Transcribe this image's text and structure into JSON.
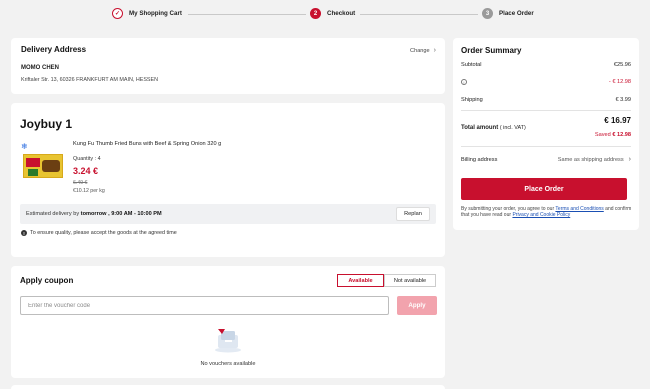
{
  "steps": [
    {
      "num": "✓",
      "label": "My Shopping Cart"
    },
    {
      "num": "2",
      "label": "Checkout"
    },
    {
      "num": "3",
      "label": "Place Order"
    }
  ],
  "delivery": {
    "title": "Delivery Address",
    "change": "Change",
    "name": "MOMO CHEN",
    "address": "Kriftaler Str. 13, 60326 FRANKFURT AM MAIN, HESSEN"
  },
  "seller": {
    "title": "Joybuy 1",
    "product_name": "Kung Fu Thumb Fried Buns with Beef & Spring Onion 320 g",
    "quantity": "Quantity : 4",
    "price": "3.24 €",
    "old_price": "6.49 €",
    "per_kg": "€10.12 per kg",
    "est_prefix": "Estimated delivery by",
    "est_value": "tomorrow , 9:00 AM - 10:00 PM",
    "replan": "Replan",
    "note": "To ensure quality, please accept the goods at the agreed time"
  },
  "coupon": {
    "title": "Apply coupon",
    "tab_available": "Available",
    "tab_not_available": "Not available",
    "placeholder": "Enter the voucher code",
    "apply": "Apply",
    "empty": "No vouchers available"
  },
  "summary": {
    "title": "Order Summary",
    "subtotal_label": "Subtotal",
    "subtotal_value": "€25.96",
    "discount_value": "- € 12.98",
    "shipping_label": "Shipping",
    "shipping_value": "€ 3.99",
    "total_value": "€ 16.97",
    "total_label": "Total amount",
    "total_suffix": "( incl. VAT)",
    "saved_label": "Saved",
    "saved_value": "€ 12.98",
    "billing_label": "Billing address",
    "billing_value": "Same as shipping address",
    "place_order": "Place Order",
    "terms_prefix": "By submitting your order, you agree to our",
    "terms_link": "Terms and Conditions",
    "terms_mid": "and confirm that you have read our",
    "privacy_link": "Privacy and Cookie Policy"
  },
  "colors": {
    "accent": "#c8102e",
    "background": "#f2f2f2",
    "apply_disabled": "#f2a3ad"
  }
}
